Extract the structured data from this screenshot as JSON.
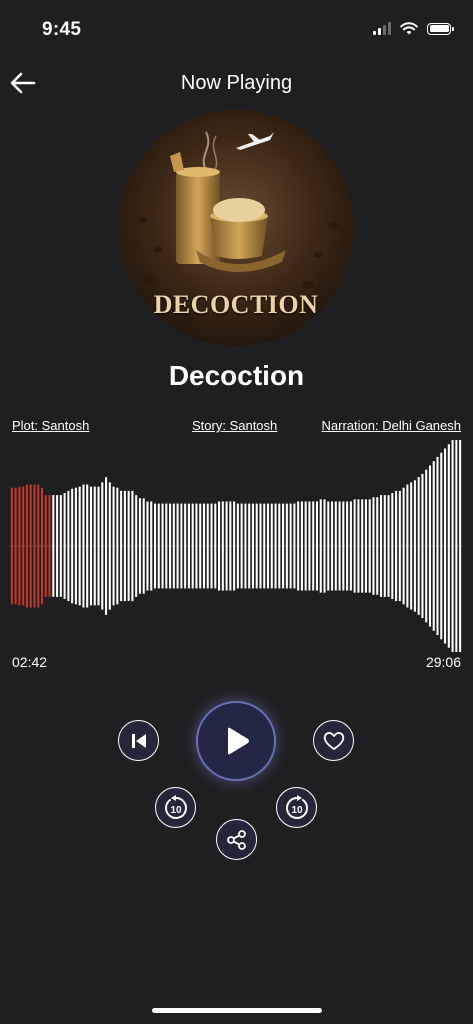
{
  "status_bar": {
    "time": "9:45"
  },
  "header": {
    "title": "Now Playing",
    "back_icon": "arrow-left-icon"
  },
  "cover": {
    "text": "DECOCTION"
  },
  "track": {
    "title": "Decoction"
  },
  "credits": {
    "plot": "Plot: Santosh",
    "story": "Story: Santosh",
    "narration": "Narration: Delhi Ganesh"
  },
  "playback": {
    "elapsed": "02:42",
    "total": "29:06",
    "progress": 0.093,
    "played_color": "#c0392b",
    "unplayed_color": "#ffffff"
  },
  "waveform_levels": [
    0.55,
    0.55,
    0.56,
    0.56,
    0.58,
    0.58,
    0.58,
    0.58,
    0.55,
    0.48,
    0.48,
    0.48,
    0.48,
    0.48,
    0.5,
    0.52,
    0.54,
    0.55,
    0.56,
    0.58,
    0.58,
    0.56,
    0.56,
    0.56,
    0.6,
    0.65,
    0.6,
    0.56,
    0.55,
    0.52,
    0.52,
    0.52,
    0.52,
    0.48,
    0.45,
    0.45,
    0.42,
    0.42,
    0.4,
    0.4,
    0.4,
    0.4,
    0.4,
    0.4,
    0.4,
    0.4,
    0.4,
    0.4,
    0.4,
    0.4,
    0.4,
    0.4,
    0.4,
    0.4,
    0.4,
    0.42,
    0.42,
    0.42,
    0.42,
    0.42,
    0.4,
    0.4,
    0.4,
    0.4,
    0.4,
    0.4,
    0.4,
    0.4,
    0.4,
    0.4,
    0.4,
    0.4,
    0.4,
    0.4,
    0.4,
    0.4,
    0.42,
    0.42,
    0.42,
    0.42,
    0.42,
    0.42,
    0.44,
    0.44,
    0.42,
    0.42,
    0.42,
    0.42,
    0.42,
    0.42,
    0.42,
    0.44,
    0.44,
    0.44,
    0.44,
    0.44,
    0.46,
    0.46,
    0.48,
    0.48,
    0.48,
    0.5,
    0.52,
    0.52,
    0.55,
    0.58,
    0.6,
    0.62,
    0.65,
    0.68,
    0.72,
    0.76,
    0.8,
    0.84,
    0.88,
    0.92,
    0.96,
    1.0,
    1.0,
    1.0
  ],
  "controls": {
    "previous_icon": "skip-previous-icon",
    "play_icon": "play-icon",
    "favorite_icon": "heart-icon",
    "rewind_icon": "rewind-10-icon",
    "forward_icon": "forward-10-icon",
    "share_icon": "share-icon",
    "skip_seconds": "10"
  }
}
